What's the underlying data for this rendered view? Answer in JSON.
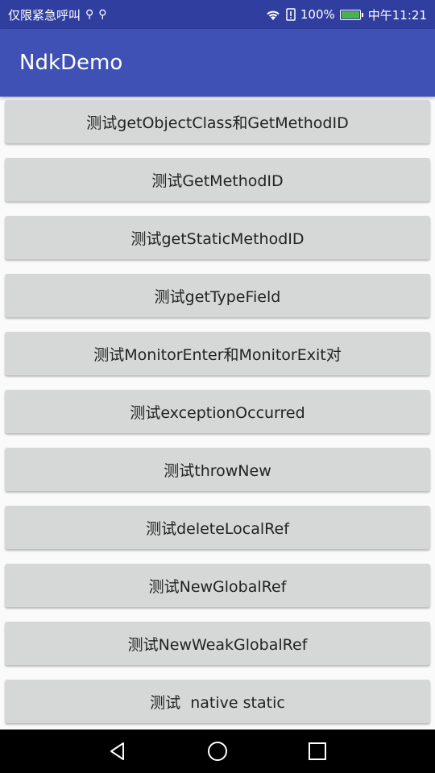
{
  "status_bar": {
    "left_text": "仅限紧急呼叫",
    "usb_icons": [
      "usb-icon",
      "usb-icon"
    ],
    "battery_percent": "100%",
    "time": "中午11:21"
  },
  "app_bar": {
    "title": "NdkDemo"
  },
  "buttons": [
    "测试getObjectClass和GetMethodID",
    "测试GetMethodID",
    "测试getStaticMethodID",
    "测试getTypeField",
    "测试MonitorEnter和MonitorExit对",
    "测试exceptionOccurred",
    "测试throwNew",
    "测试deleteLocalRef",
    "测试NewGlobalRef",
    "测试NewWeakGlobalRef",
    "测试  native static"
  ],
  "nav_bar": {
    "icons": [
      "back-icon",
      "home-icon",
      "recents-icon"
    ]
  },
  "colors": {
    "status_bar_bg": "#303f9f",
    "app_bar_bg": "#3f51b5",
    "button_bg": "#d6d7d7",
    "battery_fill": "#4caf50"
  }
}
